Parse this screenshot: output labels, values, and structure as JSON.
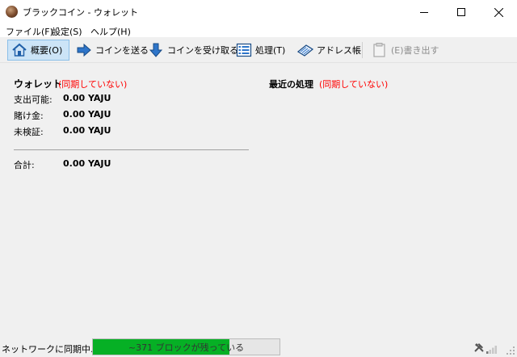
{
  "window": {
    "title": "ブラックコイン - ウォレット"
  },
  "menu": {
    "file": "ファイル(F)",
    "settings": "設定(S)",
    "help": "ヘルプ(H)"
  },
  "toolbar": {
    "overview": "概要(O)",
    "send": "コインを送る",
    "receive": "コインを受け取る",
    "transactions": "処理(T)",
    "address_book": "アドレス帳",
    "export": "(E)書き出す"
  },
  "wallet": {
    "title": "ウォレット",
    "status": "(同期していない)",
    "rows": [
      {
        "label": "支出可能:",
        "value": "0.00 YAJU"
      },
      {
        "label": "賭け金:",
        "value": "0.00 YAJU"
      },
      {
        "label": "未検証:",
        "value": "0.00 YAJU"
      }
    ],
    "total": {
      "label": "合計:",
      "value": "0.00 YAJU"
    }
  },
  "recent": {
    "title": "最近の処理",
    "status": "(同期していない)"
  },
  "status_bar": {
    "sync_label": "ネットワークに同期中.......",
    "progress_text": "~371 ブロックが残っている",
    "progress_fraction": 0.73
  },
  "colors": {
    "accent_red": "#ff0000",
    "progress_green": "#06b025",
    "toolbar_active_bg": "#cce4f7"
  }
}
